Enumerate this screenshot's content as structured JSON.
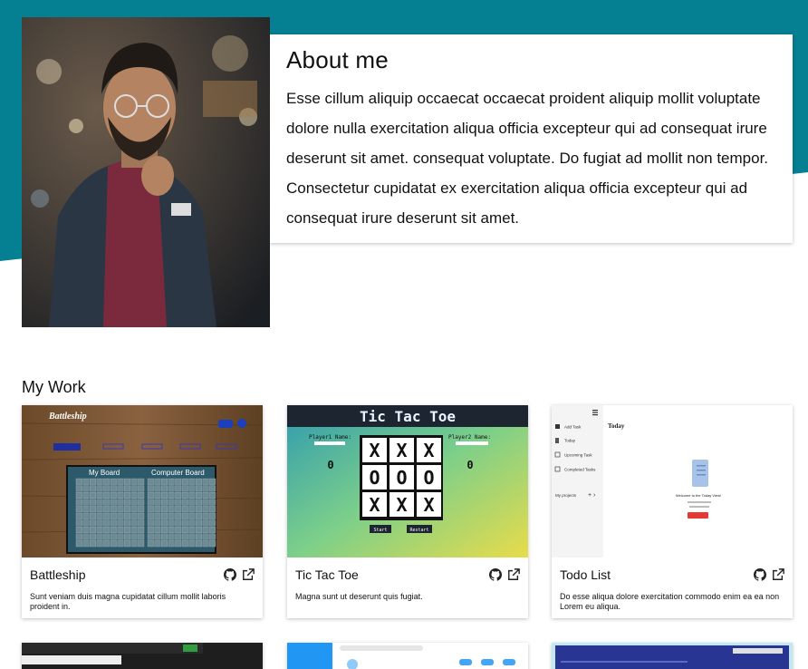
{
  "about": {
    "title": "About me",
    "body": "Esse cillum aliquip occaecat occaecat proident aliquip mollit voluptate dolore nulla exercitation aliqua officia excepteur qui ad consequat irure deserunt sit amet. consequat voluptate. Do fugiat ad mollit non tempor. Consectetur cupidatat ex exercitation aliqua officia excepteur qui ad consequat irure deserunt sit amet."
  },
  "work": {
    "title": "My Work",
    "projects": [
      {
        "title": "Battleship",
        "desc": "Sunt veniam duis magna cupidatat cillum mollit laboris proident in.",
        "shot": {
          "title": "Battleship",
          "board1": "My Board",
          "board2": "Computer Board"
        }
      },
      {
        "title": "Tic Tac Toe",
        "desc": "Magna sunt ut deserunt quis fugiat.",
        "shot": {
          "title": "Tic Tac Toe",
          "p1": "Player1 Name:",
          "p2": "Player2 Name:",
          "score1": "0",
          "score2": "0",
          "start": "Start",
          "restart": "Restart",
          "cells": [
            "X",
            "X",
            "X",
            "O",
            "O",
            "O",
            "X",
            "X",
            "X"
          ]
        }
      },
      {
        "title": "Todo List",
        "desc": "Do esse aliqua dolore exercitation commodo enim ea ea non Lorem eu aliqua.",
        "shot": {
          "menu": [
            "Add Task",
            "Today",
            "Upcoming Task",
            "Completed Tasks"
          ],
          "projects": "My projects",
          "heading": "Today",
          "welcome": "Welcome to the Today View!"
        }
      }
    ]
  },
  "colors": {
    "teal": "#057f92",
    "accent": "#00838f"
  },
  "icons": {
    "github": "github-icon",
    "external": "external-link-icon"
  }
}
